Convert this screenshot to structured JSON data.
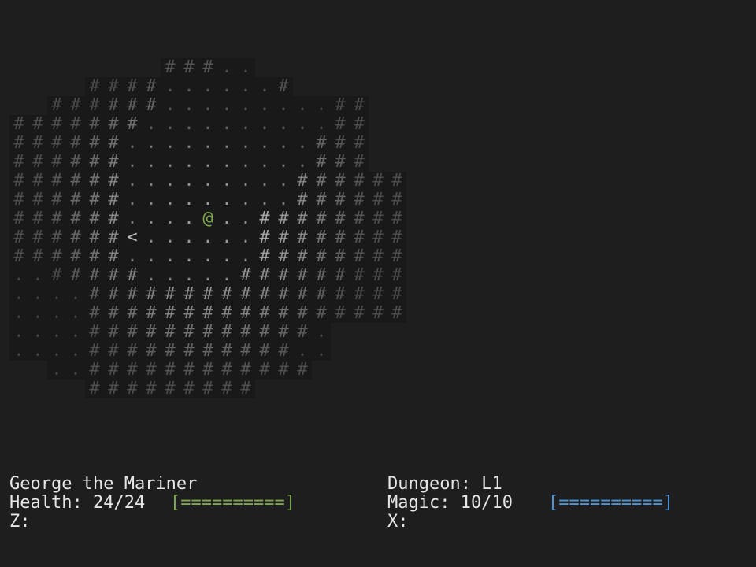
{
  "colors": {
    "background": "#1e1e1e",
    "explored_floor_bg": "#191919",
    "player": "#7ea84f",
    "health_bar": "#7ea84f",
    "magic_bar": "#4f95d6",
    "text": "#e6e6e6"
  },
  "map": {
    "legend": {
      "#": "wall",
      ".": "floor",
      "@": "player",
      "<": "stairs-up"
    },
    "rows": [
      "        ###..",
      "    ####......#",
      "  ######.........##",
      "#######..........##",
      "######..........###",
      "######..........###",
      "######.........######",
      "######.........######",
      "######....@..########",
      "######<......########",
      "######.......########",
      "..#####.....#########",
      "....#################",
      "....#################",
      "....############.",
      "....###########..",
      "  ..############",
      "    #########"
    ],
    "player_symbol": "@",
    "stairs_symbol": "<"
  },
  "status": {
    "character_name": "George the Mariner",
    "health_label": "Health: 24/24",
    "health_bar": "[==========]",
    "z_label": "Z:",
    "dungeon_label": "Dungeon: L1",
    "magic_label": "Magic: 10/10",
    "magic_bar": "[==========]",
    "x_label": "X:"
  }
}
